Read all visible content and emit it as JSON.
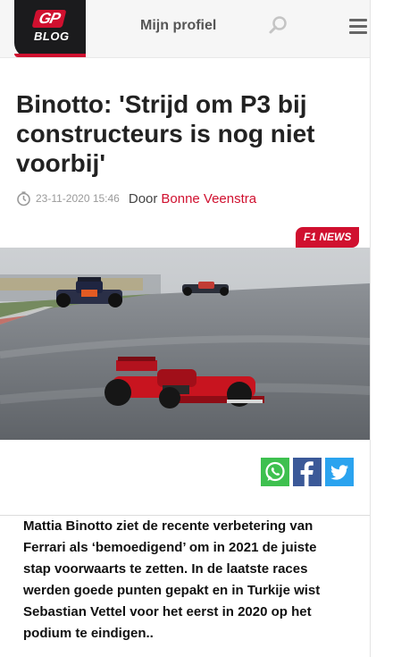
{
  "header": {
    "logo": {
      "top": "GP",
      "bottom": "BLOG"
    },
    "profile_label": "Mijn profiel",
    "search_icon": "search-icon",
    "menu_icon": "hamburger-menu-icon"
  },
  "article": {
    "title": "Binotto: 'Strijd om P3 bij constructeurs is nog niet voorbij'",
    "date": "23-11-2020 15:46",
    "by_label": "Door",
    "author": "Bonne Veenstra",
    "category_badge": "F1 NEWS",
    "lead": "Mattia Binotto ziet de recente verbetering van Ferrari als ‘bemoedigend’ om in 2021 de juiste stap voorwaarts te zetten. In de laatste races werden goede punten gepakt en in Turkije wist Sebastian Vettel voor het eerst in 2020 op het podium te eindigen.."
  },
  "share": [
    "whatsapp-icon",
    "facebook-icon",
    "twitter-icon"
  ],
  "colors": {
    "brand_red": "#d0102f",
    "dark": "#1b1b1d",
    "whatsapp": "#3ec04f",
    "facebook": "#3b5998",
    "twitter": "#2aa3ef"
  }
}
